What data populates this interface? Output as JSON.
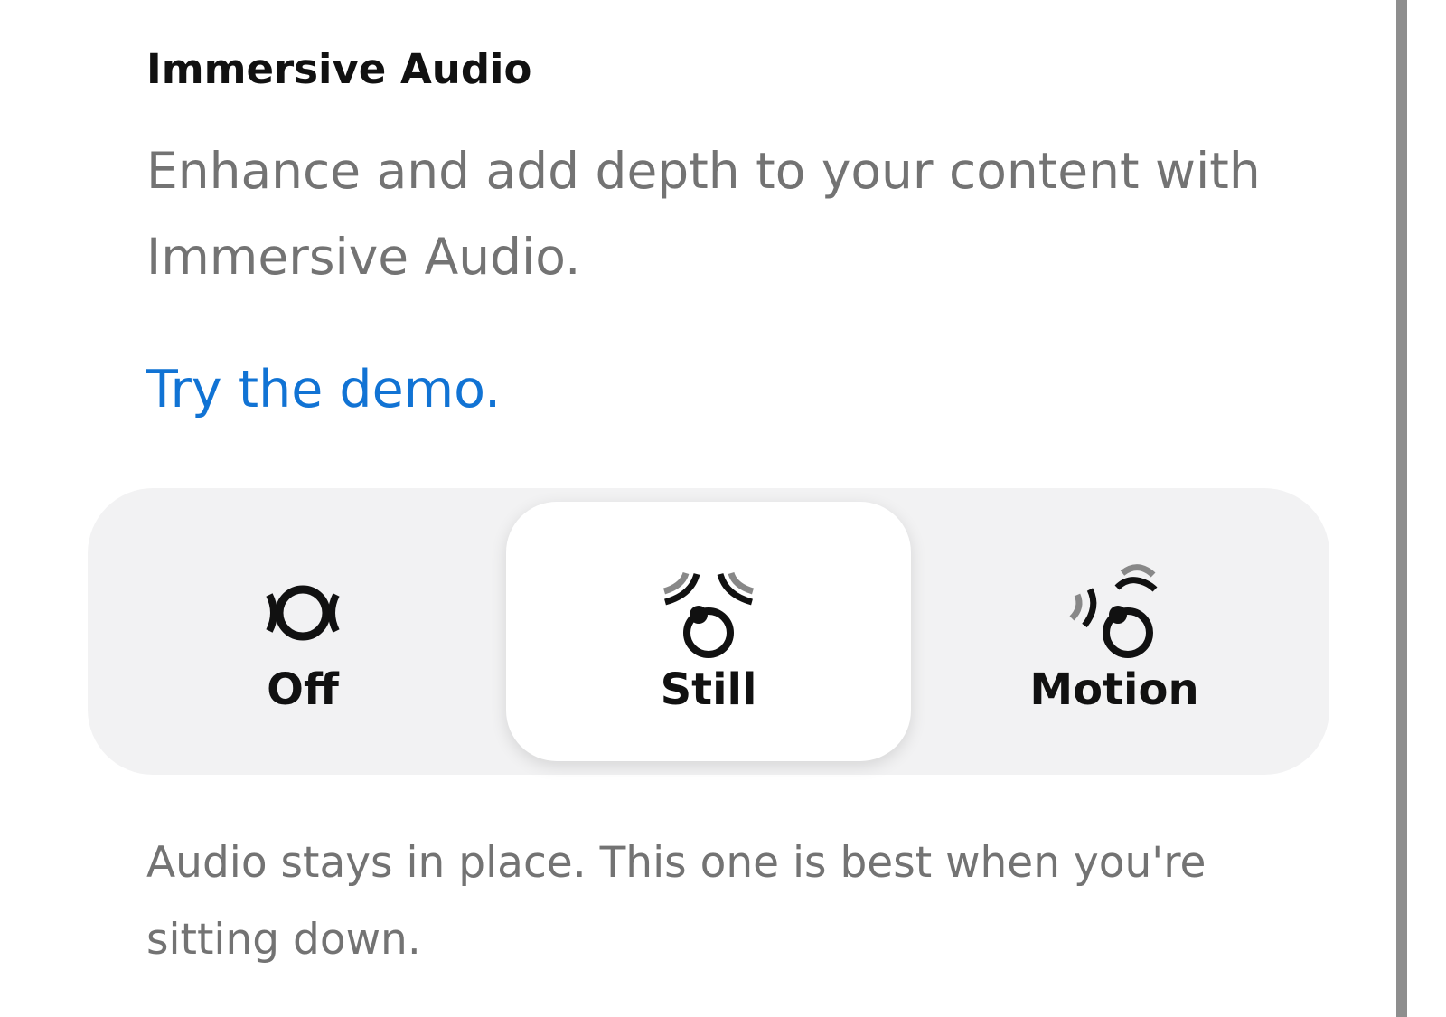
{
  "section": {
    "title": "Immersive Audio",
    "description": "Enhance and add depth to your content with Immersive Audio.",
    "demo_link": "Try the demo."
  },
  "modes": {
    "selected": "Still",
    "options": [
      {
        "label": "Off",
        "icon": "off-mode-icon"
      },
      {
        "label": "Still",
        "icon": "still-mode-icon"
      },
      {
        "label": "Motion",
        "icon": "motion-mode-icon"
      }
    ]
  },
  "caption": "Audio stays in place. This one is best when you're sitting down.",
  "colors": {
    "link": "#1173d4",
    "selected_background": "#ffffff",
    "control_background": "#f2f2f3",
    "secondary_text": "#737373"
  }
}
